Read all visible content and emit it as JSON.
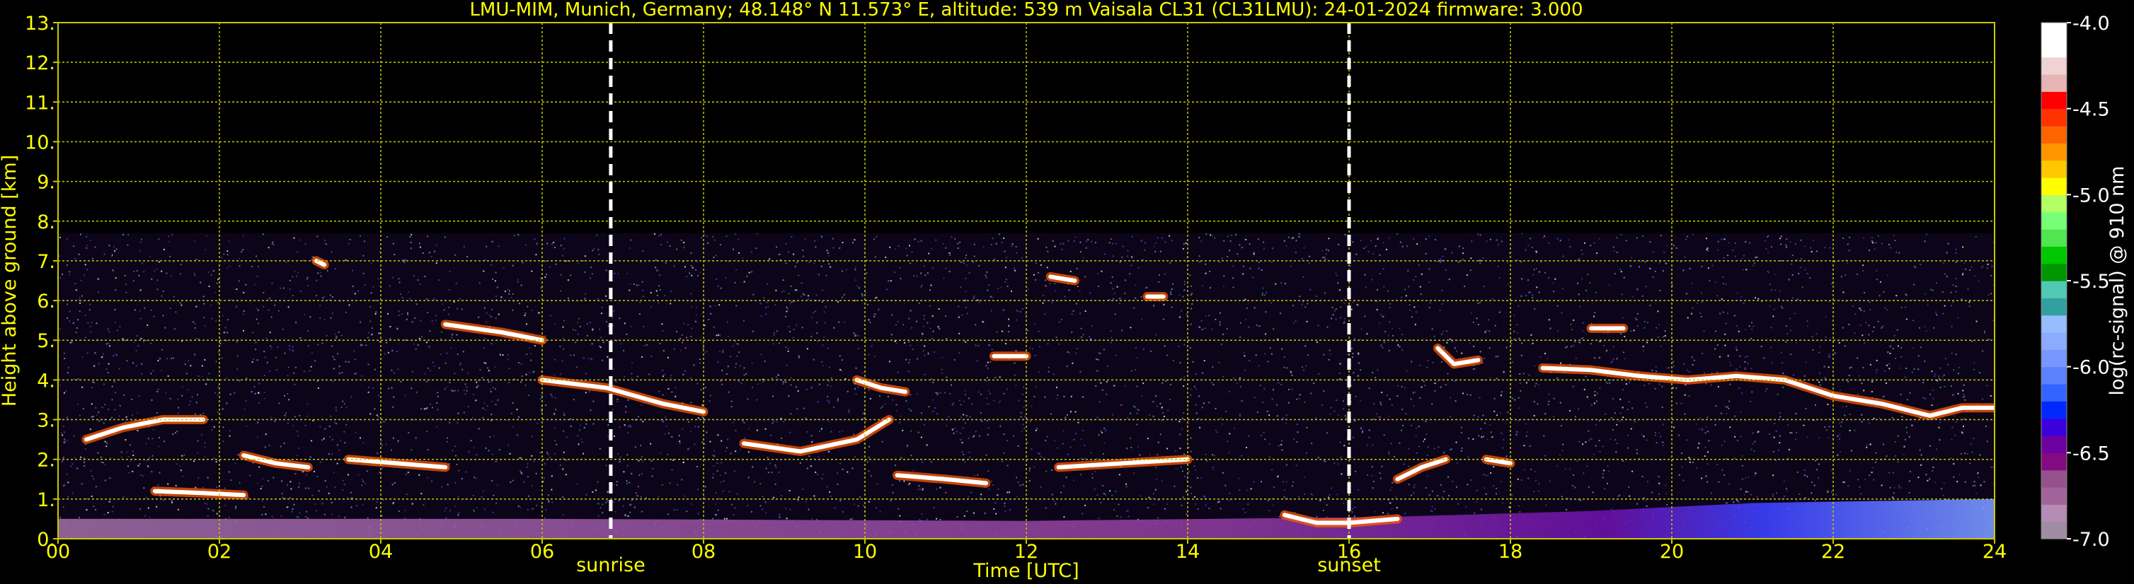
{
  "chart_data": {
    "type": "heatmap",
    "title": "LMU-MIM, Munich, Germany; 48.148° N 11.573° E, altitude: 539 m    Vaisala CL31 (CL31LMU): 24-01-2024    firmware: 3.000",
    "xlabel": "Time [UTC]",
    "ylabel": "Height above ground [km]",
    "xlim": [
      0,
      24
    ],
    "ylim": [
      0,
      13
    ],
    "x_ticks": [
      "00",
      "02",
      "04",
      "06",
      "08",
      "10",
      "12",
      "14",
      "16",
      "18",
      "20",
      "22",
      "24"
    ],
    "y_ticks": [
      "0.",
      "1.",
      "2.",
      "3.",
      "4.",
      "5.",
      "6.",
      "7.",
      "8.",
      "9.",
      "10.",
      "11.",
      "12.",
      "13."
    ],
    "grid": true,
    "grid_color": "#c8c800",
    "background_color": "#000000",
    "signal_ceiling_km": 7.7,
    "annotations": [
      {
        "label": "sunrise",
        "x": 6.85
      },
      {
        "label": "sunset",
        "x": 16.0
      }
    ],
    "colorbar": {
      "label": "log(rc-signal) @ 910 nm",
      "range": [
        -7.0,
        -4.0
      ],
      "ticks": [
        "-4.0",
        "-4.5",
        "-5.0",
        "-5.5",
        "-6.0",
        "-6.5",
        "-7.0"
      ],
      "colors": [
        "#a08ca0",
        "#b48cb4",
        "#a0649b",
        "#96508c",
        "#820a82",
        "#6e00a0",
        "#3c00dc",
        "#0028ff",
        "#3264ff",
        "#5a82ff",
        "#7896ff",
        "#8caaff",
        "#96beff",
        "#32a0a0",
        "#50c8b4",
        "#009600",
        "#00c800",
        "#50e650",
        "#78ff78",
        "#b4ff64",
        "#ffff00",
        "#ffc800",
        "#ff9600",
        "#ff6400",
        "#ff3200",
        "#ff0000",
        "#e6b4b4",
        "#f0d2d2",
        "#ffffff",
        "#ffffff"
      ]
    },
    "features": [
      {
        "kind": "cloud-layer",
        "points": [
          [
            0.35,
            2.5
          ],
          [
            0.8,
            2.8
          ],
          [
            1.3,
            3.0
          ],
          [
            1.8,
            3.0
          ]
        ]
      },
      {
        "kind": "cloud-layer",
        "points": [
          [
            1.2,
            1.2
          ],
          [
            1.8,
            1.15
          ],
          [
            2.3,
            1.1
          ]
        ]
      },
      {
        "kind": "cloud-layer",
        "points": [
          [
            2.3,
            2.1
          ],
          [
            2.7,
            1.9
          ],
          [
            3.1,
            1.8
          ]
        ]
      },
      {
        "kind": "cloud-layer",
        "points": [
          [
            3.6,
            2.0
          ],
          [
            4.2,
            1.9
          ],
          [
            4.8,
            1.8
          ]
        ]
      },
      {
        "kind": "cloud-layer",
        "points": [
          [
            4.8,
            5.4
          ],
          [
            5.5,
            5.2
          ],
          [
            6.0,
            5.0
          ]
        ]
      },
      {
        "kind": "cloud-layer",
        "points": [
          [
            6.0,
            4.0
          ],
          [
            6.8,
            3.8
          ],
          [
            7.5,
            3.4
          ],
          [
            8.0,
            3.2
          ]
        ]
      },
      {
        "kind": "cloud-layer",
        "points": [
          [
            8.5,
            2.4
          ],
          [
            9.2,
            2.2
          ],
          [
            9.9,
            2.5
          ],
          [
            10.3,
            3.0
          ]
        ]
      },
      {
        "kind": "cloud-layer",
        "points": [
          [
            9.9,
            4.0
          ],
          [
            10.2,
            3.8
          ],
          [
            10.5,
            3.7
          ]
        ]
      },
      {
        "kind": "cloud-layer",
        "points": [
          [
            10.4,
            1.6
          ],
          [
            11.0,
            1.5
          ],
          [
            11.5,
            1.4
          ]
        ]
      },
      {
        "kind": "cloud-layer",
        "points": [
          [
            11.6,
            4.6
          ],
          [
            12.0,
            4.6
          ]
        ]
      },
      {
        "kind": "cloud-layer",
        "points": [
          [
            12.4,
            1.8
          ],
          [
            13.2,
            1.9
          ],
          [
            14.0,
            2.0
          ]
        ]
      },
      {
        "kind": "cloud-layer",
        "points": [
          [
            15.2,
            0.6
          ],
          [
            15.6,
            0.4
          ],
          [
            16.0,
            0.4
          ],
          [
            16.6,
            0.5
          ]
        ]
      },
      {
        "kind": "cloud-layer",
        "points": [
          [
            16.6,
            1.5
          ],
          [
            16.9,
            1.8
          ],
          [
            17.2,
            2.0
          ]
        ]
      },
      {
        "kind": "cloud-layer",
        "points": [
          [
            17.1,
            4.8
          ],
          [
            17.3,
            4.4
          ],
          [
            17.6,
            4.5
          ]
        ]
      },
      {
        "kind": "cloud-layer",
        "points": [
          [
            18.4,
            4.3
          ],
          [
            19.0,
            4.25
          ],
          [
            19.6,
            4.1
          ],
          [
            20.2,
            4.0
          ],
          [
            20.8,
            4.1
          ],
          [
            21.4,
            4.0
          ],
          [
            22.0,
            3.6
          ],
          [
            22.6,
            3.4
          ],
          [
            23.2,
            3.1
          ],
          [
            23.6,
            3.3
          ],
          [
            24.0,
            3.3
          ]
        ]
      },
      {
        "kind": "cloud-layer",
        "points": [
          [
            17.7,
            2.0
          ],
          [
            18.0,
            1.9
          ]
        ]
      },
      {
        "kind": "cloud-layer",
        "points": [
          [
            19.0,
            5.3
          ],
          [
            19.4,
            5.3
          ]
        ]
      },
      {
        "kind": "cloud-layer",
        "points": [
          [
            12.3,
            6.6
          ],
          [
            12.6,
            6.5
          ]
        ]
      },
      {
        "kind": "cloud-layer",
        "points": [
          [
            3.2,
            7.0
          ],
          [
            3.3,
            6.9
          ]
        ]
      },
      {
        "kind": "cloud-layer",
        "points": [
          [
            13.5,
            6.1
          ],
          [
            13.7,
            6.1
          ]
        ]
      },
      {
        "kind": "boundary-layer",
        "points": [
          [
            0,
            0.5
          ],
          [
            6,
            0.5
          ],
          [
            12,
            0.45
          ],
          [
            16.5,
            0.55
          ],
          [
            19,
            0.7
          ],
          [
            21,
            0.9
          ],
          [
            24,
            1.0
          ]
        ]
      }
    ]
  }
}
